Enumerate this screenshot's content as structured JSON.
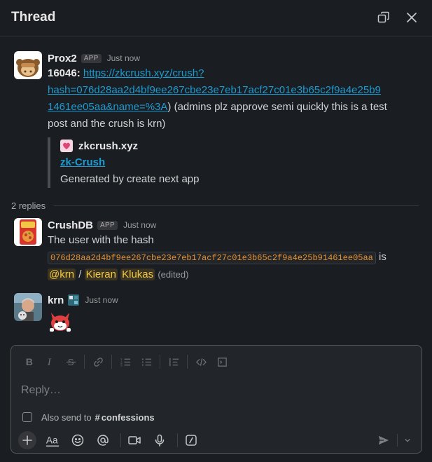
{
  "header": {
    "title": "Thread"
  },
  "parent_message": {
    "author": "Prox2",
    "badge": "APP",
    "time": "Just now",
    "number": "16046:",
    "link_text": "https://zkcrush.xyz/crush?hash=076d28aa2d4bf9ee267cbe23e7eb17acf27c01e3b65c2f9a4e25b91461ee05aa&name=%3A",
    "link_line1": "https://zkcrush.xyz/crush?",
    "link_line2": "hash=076d28aa2d4bf9ee267cbe23e7eb17acf27c01e3b65c2f9a4e25b9",
    "link_line3": "1461ee05aa&name=%3A",
    "after_link": ") (admins plz approve semi quickly this is a test",
    "line4": "post and the crush is krn)",
    "unfurl": {
      "site_name": "zkcrush.xyz",
      "title": "zk-Crush",
      "description": "Generated by create next app"
    }
  },
  "replies_label": "2 replies",
  "reply1": {
    "author": "CrushDB",
    "badge": "APP",
    "time": "Just now",
    "line1": "The user with the hash",
    "hash_code": "076d28aa2d4bf9ee267cbe23e7eb17acf27c01e3b65c2f9a4e25b91461ee05aa",
    "is_text": "is",
    "mention": "@krn",
    "slash": "/",
    "name_first": "Kieran",
    "name_last": "Klukas",
    "edited": "(edited)"
  },
  "reply2": {
    "author": "krn",
    "time": "Just now"
  },
  "composer": {
    "placeholder": "Reply…",
    "also_send_label": "Also send to",
    "hash_symbol": "#",
    "channel": "confessions"
  },
  "icons": {
    "header": [
      "popout-icon",
      "close-icon"
    ],
    "formatting": [
      "bold-icon",
      "italic-icon",
      "strikethrough-icon",
      "link-icon",
      "ordered-list-icon",
      "bulleted-list-icon",
      "blockquote-icon",
      "code-icon",
      "code-block-icon"
    ],
    "bottom": [
      "plus-icon",
      "text-format-icon",
      "emoji-icon",
      "mention-icon",
      "video-icon",
      "microphone-icon",
      "slash-command-icon",
      "send-icon",
      "chevron-down-icon"
    ]
  },
  "colors": {
    "background": "#1a1d21",
    "link": "#1d9bd1",
    "code": "#e8912d",
    "mention": "#f2c744"
  }
}
